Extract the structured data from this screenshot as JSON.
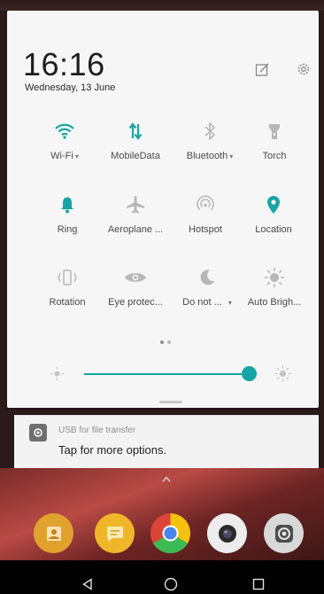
{
  "status": {
    "time": "16:16",
    "date": "Wednesday, 13 June"
  },
  "header": {
    "edit_icon": "edit-icon",
    "settings_icon": "gear-icon"
  },
  "tiles_row1": [
    {
      "label": "Wi-Fi",
      "caret": "▾",
      "icon": "wifi-icon",
      "active": true
    },
    {
      "label": "MobileData",
      "icon": "mobile-data-icon",
      "active": true
    },
    {
      "label": "Bluetooth",
      "caret": "▾",
      "icon": "bluetooth-icon",
      "active": false
    },
    {
      "label": "Torch",
      "icon": "torch-icon",
      "active": false
    }
  ],
  "tiles_row2": [
    {
      "label": "Ring",
      "icon": "bell-icon",
      "active": true
    },
    {
      "label": "Aeroplane ...",
      "icon": "airplane-icon",
      "active": false
    },
    {
      "label": "Hotspot",
      "icon": "hotspot-icon",
      "active": false
    },
    {
      "label": "Location",
      "icon": "location-icon",
      "active": true
    }
  ],
  "tiles_row3": [
    {
      "label": "Rotation",
      "icon": "rotation-icon",
      "active": false
    },
    {
      "label": "Eye protec...",
      "icon": "eye-icon",
      "active": false
    },
    {
      "label": "Do not ...",
      "caret": "▾",
      "icon": "moon-icon",
      "active": false
    },
    {
      "label": "Auto Brigh...",
      "icon": "auto-brightness-icon",
      "active": false
    }
  ],
  "brightness": {
    "level": 0.95
  },
  "notification": {
    "title": "USB for file transfer",
    "body": "Tap for more options."
  },
  "colors": {
    "accent": "#17a4a4",
    "inactive": "#b7b7b7",
    "panel": "#f6f6f7"
  },
  "dock": [
    {
      "icon": "contacts-icon"
    },
    {
      "icon": "messages-icon"
    },
    {
      "icon": "chrome-icon"
    },
    {
      "icon": "camera-icon"
    },
    {
      "icon": "screen-record-icon"
    }
  ],
  "navigation": {
    "back": "back-icon",
    "home": "home-icon",
    "recents": "recents-icon"
  }
}
